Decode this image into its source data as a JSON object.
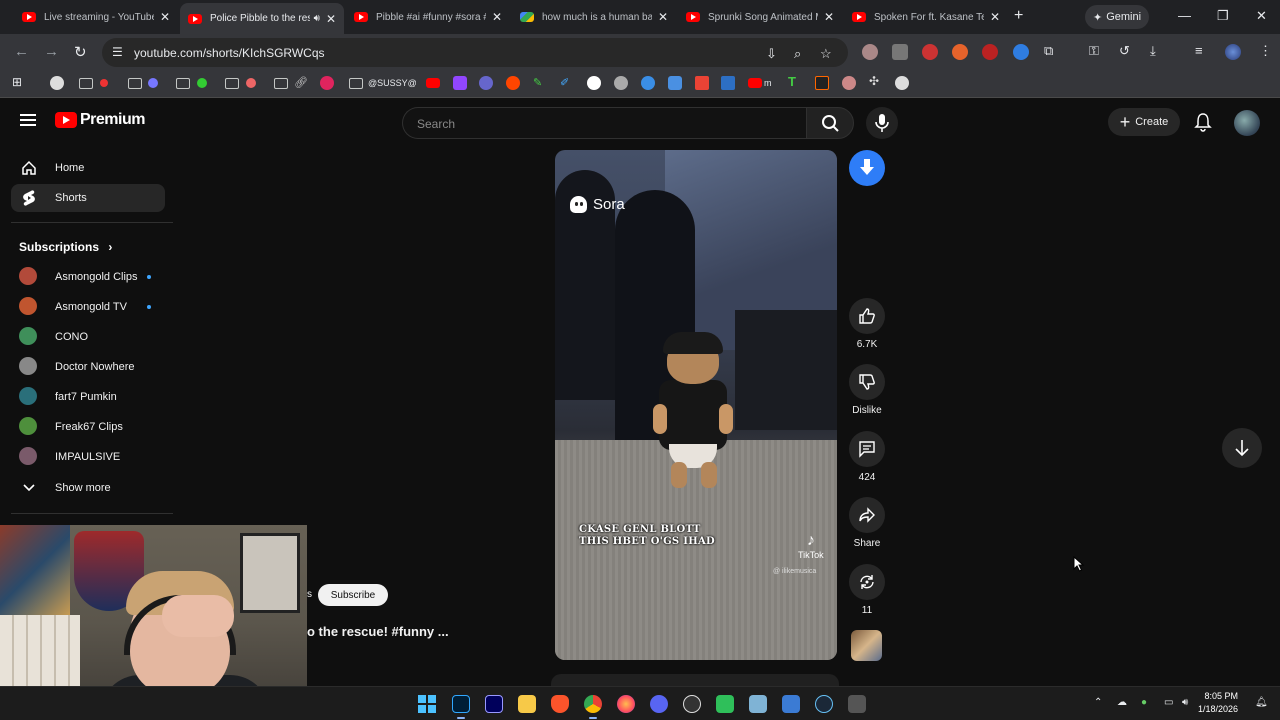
{
  "browser": {
    "tabs": [
      {
        "title": "Live streaming - YouTube Studio",
        "icon": "youtube",
        "active": false
      },
      {
        "title": "Police Pibble to the rescue!",
        "icon": "youtube",
        "active": true,
        "audio": true
      },
      {
        "title": "Pibble #ai #funny #sora #pibble",
        "icon": "youtube",
        "active": false
      },
      {
        "title": "how much is a human ball",
        "icon": "google",
        "active": false
      },
      {
        "title": "Sprunki Song Animated Music",
        "icon": "youtube",
        "active": false
      },
      {
        "title": "Spoken For ft. Kasane Teto",
        "icon": "youtube",
        "active": false
      }
    ],
    "gemini_label": "Gemini",
    "url": "youtube.com/shorts/KIchSGRWCqs",
    "bookmark_label": "@SUSSY@",
    "extension_badge": "20"
  },
  "youtube": {
    "logo_text": "Premium",
    "search_placeholder": "Search",
    "create_label": "Create",
    "sidebar": {
      "home": "Home",
      "shorts": "Shorts",
      "subscriptions_title": "Subscriptions",
      "channels": [
        {
          "name": "Asmongold Clips",
          "new": true,
          "color": "#b24a3a"
        },
        {
          "name": "Asmongold TV",
          "new": true,
          "color": "#c0552f"
        },
        {
          "name": "CONO",
          "new": false,
          "color": "#3f8f5a"
        },
        {
          "name": "Doctor Nowhere",
          "new": false,
          "color": "#888888"
        },
        {
          "name": "fart7 Pumkin",
          "new": false,
          "color": "#2a6f7a"
        },
        {
          "name": "Freak67 Clips",
          "new": false,
          "color": "#4e8f3c"
        },
        {
          "name": "IMPAULSIVE",
          "new": false,
          "color": "#7a5a6a"
        }
      ],
      "show_more": "Show more"
    },
    "short": {
      "watermark": "Sora",
      "caption_line1": "CKASE GENL BLOTT",
      "caption_line2": "THIS HBET O'GS IHAD",
      "tiktok_label": "TikTok",
      "tiktok_user": "@ ilikemusica",
      "title": "o the rescue! #funny ..."
    },
    "actions": {
      "likes": "6.7K",
      "dislike": "Dislike",
      "comments": "424",
      "share": "Share",
      "remix": "11"
    },
    "subscribe_label": "Subscribe"
  },
  "taskbar": {
    "time": "8:05 PM",
    "date": "1/18/2026"
  }
}
